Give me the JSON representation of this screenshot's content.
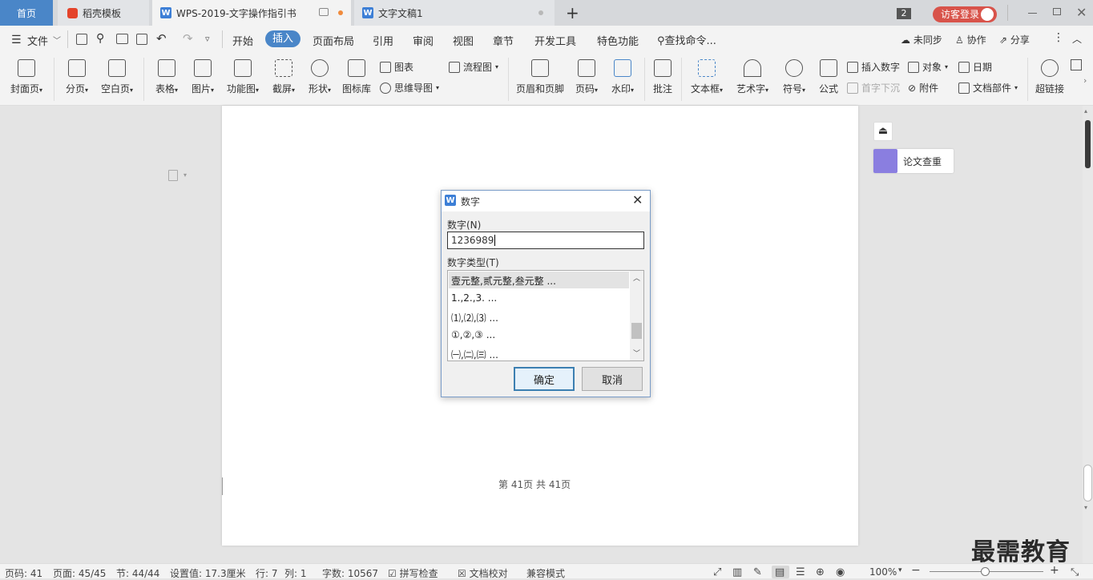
{
  "tabs": {
    "home": "首页",
    "template": "稻壳模板",
    "doc": "WPS-2019-文字操作指引书",
    "doc2": "文字文稿1",
    "new": "+"
  },
  "titlebar": {
    "badge": "2",
    "login": "访客登录"
  },
  "menu": {
    "file": "文件",
    "items": [
      "开始",
      "插入",
      "页面布局",
      "引用",
      "审阅",
      "视图",
      "章节",
      "开发工具",
      "特色功能"
    ],
    "search": "查找命令...",
    "sync": "未同步",
    "collab": "协作",
    "share": "分享"
  },
  "ribbon": {
    "big": [
      "封面页",
      "分页",
      "空白页",
      "表格",
      "图片",
      "功能图",
      "截屏",
      "形状",
      "图标库",
      "页眉和页脚",
      "页码",
      "水印",
      "批注",
      "文本框",
      "艺术字",
      "符号",
      "公式",
      "超链接"
    ],
    "small": {
      "chart": "图表",
      "flow": "流程图",
      "mind": "思维导图",
      "insertnum": "插入数字",
      "object": "对象",
      "date": "日期",
      "dropcap": "首字下沉",
      "attach": "附件",
      "docpart": "文档部件"
    }
  },
  "side": {
    "paper_check": "论文查重"
  },
  "footer_text": {
    "di": "第",
    "page": "41",
    "ye": "页",
    "gong": "共",
    "total": "41",
    "ye2": "页"
  },
  "dialog": {
    "title": "数字",
    "number_label": "数字(N)",
    "number_value": "1236989",
    "type_label": "数字类型(T)",
    "types": [
      "壹元整,贰元整,叁元整 ...",
      "1.,2.,3. ...",
      "⑴,⑵,⑶ ...",
      "①,②,③ ...",
      "㈠,㈡,㈢ ..."
    ],
    "ok": "确定",
    "cancel": "取消"
  },
  "status": {
    "pageno": "页码: 41",
    "pages": "页面: 45/45",
    "section": "节: 44/44",
    "setting": "设置值: 17.3厘米",
    "row": "行: 7",
    "col": "列: 1",
    "words": "字数: 10567",
    "spell": "拼写检查",
    "proof": "文档校对",
    "compat": "兼容模式",
    "zoom": "100%"
  },
  "watermark": "最需教育"
}
